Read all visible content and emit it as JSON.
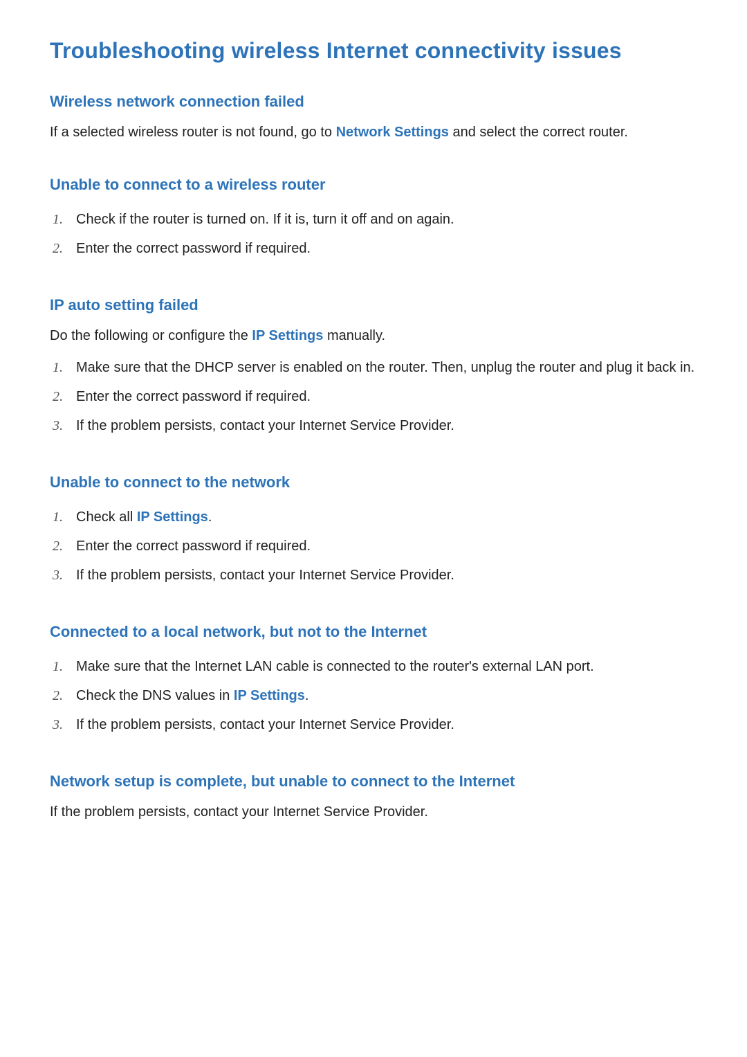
{
  "title": "Troubleshooting wireless Internet connectivity issues",
  "sections": {
    "s0": {
      "title": "Wireless network connection failed",
      "intro_pre": "If a selected wireless router is not found, go to ",
      "intro_link": "Network Settings",
      "intro_post": " and select the correct router."
    },
    "s1": {
      "title": "Unable to connect to a wireless router",
      "items": {
        "i0": "Check if the router is turned on. If it is, turn it off and on again.",
        "i1": "Enter the correct password if required."
      }
    },
    "s2": {
      "title": "IP auto setting failed",
      "intro_pre": "Do the following or configure the ",
      "intro_link": "IP Settings",
      "intro_post": " manually.",
      "items": {
        "i0": "Make sure that the DHCP server is enabled on the router. Then, unplug the router and plug it back in.",
        "i1": "Enter the correct password if required.",
        "i2": "If the problem persists, contact your Internet Service Provider."
      }
    },
    "s3": {
      "title": "Unable to connect to the network",
      "items": {
        "i0_pre": "Check all ",
        "i0_link": "IP Settings",
        "i0_post": ".",
        "i1": "Enter the correct password if required.",
        "i2": "If the problem persists, contact your Internet Service Provider."
      }
    },
    "s4": {
      "title": "Connected to a local network, but not to the Internet",
      "items": {
        "i0": "Make sure that the Internet LAN cable is connected to the router's external LAN port.",
        "i1_pre": "Check the DNS values in ",
        "i1_link": "IP Settings",
        "i1_post": ".",
        "i2": "If the problem persists, contact your Internet Service Provider."
      }
    },
    "s5": {
      "title": "Network setup is complete, but unable to connect to the Internet",
      "lone": "If the problem persists, contact your Internet Service Provider."
    }
  },
  "nums": {
    "n1": "1.",
    "n2": "2.",
    "n3": "3."
  }
}
